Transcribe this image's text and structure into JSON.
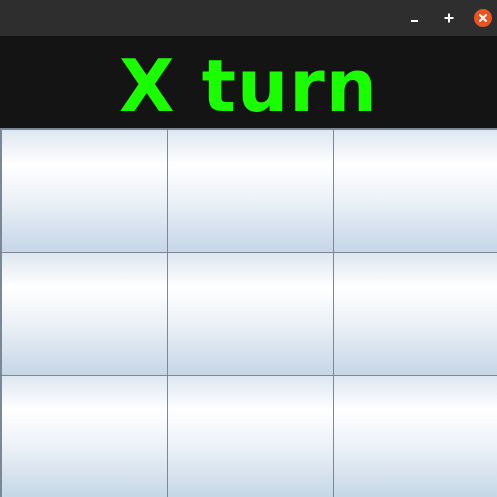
{
  "window": {
    "controls": {
      "minimize_icon": "minimize-icon",
      "maximize_icon": "maximize-icon",
      "close_icon": "close-icon",
      "close_color": "#e95420"
    }
  },
  "status": {
    "text": "X turn",
    "color": "#1aff00"
  },
  "board": {
    "cells": [
      [
        "",
        "",
        ""
      ],
      [
        "",
        "",
        ""
      ],
      [
        "",
        "",
        ""
      ]
    ]
  }
}
